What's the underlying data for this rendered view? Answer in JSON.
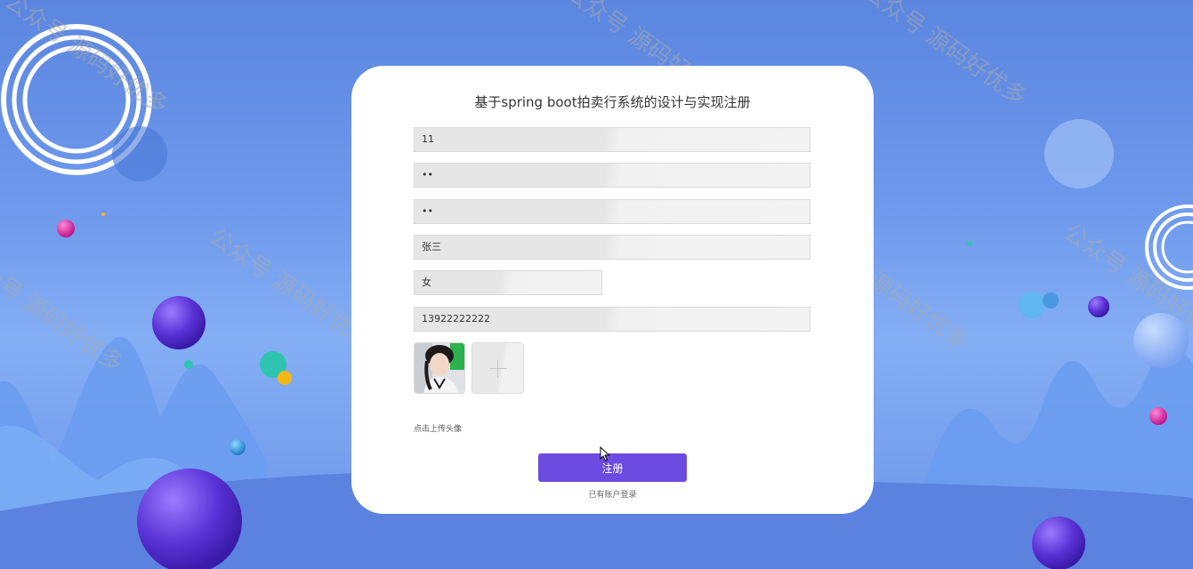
{
  "form": {
    "title": "基于spring boot拍卖行系统的设计与实现注册",
    "username": "11",
    "password": "••",
    "confirm_password": "••",
    "name": "张三",
    "gender": "女",
    "phone": "13922222222",
    "upload_label": "点击上传头像",
    "submit_label": "注册",
    "login_link": "已有账户登录"
  },
  "watermark": "公众号 源码好优多",
  "colors": {
    "primary_button": "#6c4be0",
    "background": "#6d98ec",
    "card": "#ffffff"
  }
}
